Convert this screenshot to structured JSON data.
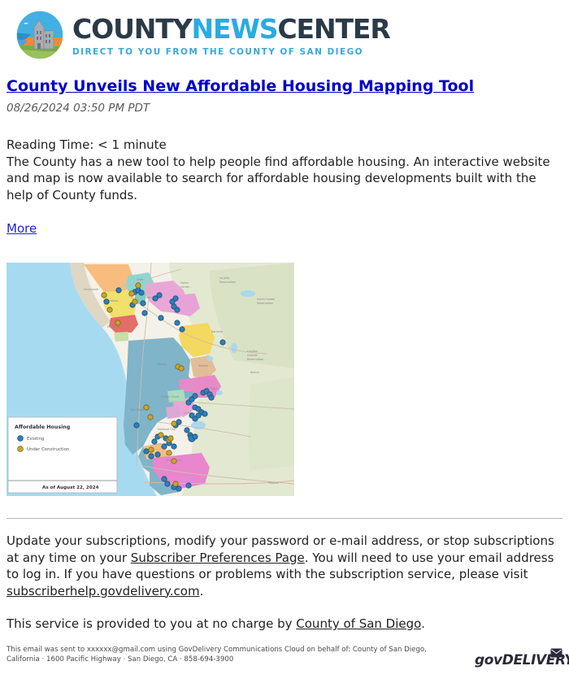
{
  "brand": {
    "emblem_icon": "county-seal-icon",
    "wordmark_part1": "COUNTY",
    "wordmark_part2": "NEWS",
    "wordmark_part3": "CENTER",
    "tagline": "DIRECT TO YOU FROM THE COUNTY OF SAN DIEGO",
    "color_dark": "#2b3a47",
    "color_blue": "#29abe2"
  },
  "article": {
    "headline": "County Unveils New Affordable Housing Mapping Tool ",
    "timestamp": "08/26/2024 03:50 PM PDT",
    "reading_time": "Reading Time: < 1 minute",
    "body": "The County has a new tool to help people find affordable housing.  An interactive website and map is now available to search for affordable housing developments built with the help of County funds.",
    "more_label": "More",
    "link_color": "#0000cc"
  },
  "map": {
    "alt_name": "san-diego-affordable-housing-map",
    "legend": {
      "title": "Affordable Housing",
      "items": [
        {
          "label": "Existing",
          "color": "#2e7ebb"
        },
        {
          "label": "Under Construction",
          "color": "#c2a32e"
        }
      ],
      "as_of": "As of August 22, 2024"
    },
    "labels": [
      "Valley Center",
      "La Jolla Reservation",
      "Santa Ysabel Reservation",
      "Oceanside",
      "Carlsbad",
      "Vista",
      "San Marcos",
      "Escondido",
      "Ramona",
      "Capitan Grande Reservation",
      "Poway",
      "Santee",
      "Alpine",
      "El Cajon",
      "San Diego",
      "La Mesa",
      "Lemon Grove",
      "National City",
      "Chula Vista",
      "Tijuana"
    ],
    "colors": {
      "ocean": "#a8d8ef",
      "land": "#f2efe6",
      "terrain_green": "#d9e3c8",
      "san_diego": "#7fb3c8",
      "oceanside": "#f7bd82",
      "carlsbad": "#f4e06a",
      "vista_teal": "#8fd5cf",
      "encinitas_red": "#e06a66",
      "pink": "#e8a8d8",
      "magenta": "#e87fc8",
      "yellow_poway": "#f2d95e",
      "tan_santee": "#e5bd95",
      "mint": "#a8ddbf"
    }
  },
  "footer": {
    "p1_before_link": "Update your subscriptions, modify your password or e-mail address, or stop subscriptions at any time on your ",
    "p1_link1": "Subscriber Preferences Page",
    "p1_mid": ". You will need to use your email address to log in. If you have questions or problems with the subscription service, please visit ",
    "p1_link2": "subscriberhelp.govdelivery.com",
    "p1_after": ".",
    "p2_before_link": "This service is provided to you at no charge by ",
    "p2_link": "County of San Diego",
    "p2_after": "."
  },
  "fineprint": {
    "line1": "This email was sent to xxxxxx@gmail.com using GovDelivery Communications Cloud on behalf of: County of San Diego,",
    "line2": "California · 1600 Pacific Highway · San Diego, CA · 858-694-3900",
    "gd_logo_text_1": "gov",
    "gd_logo_text_2": "DELIVERY",
    "gd_envelope_icon": "envelope-icon"
  }
}
